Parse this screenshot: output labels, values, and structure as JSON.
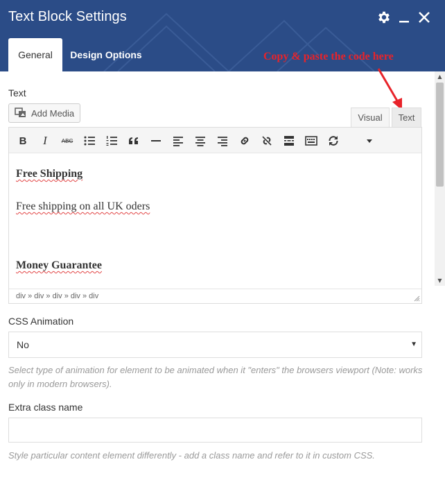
{
  "header": {
    "title": "Text Block Settings",
    "bg_color": "#2b4c87",
    "icons": [
      "gear-icon",
      "minimize-icon",
      "close-icon"
    ]
  },
  "tabs": [
    {
      "label": "General",
      "active": true
    },
    {
      "label": "Design Options",
      "active": false
    }
  ],
  "annotation": {
    "text": "Copy & paste the code here",
    "color": "#e8232a"
  },
  "text_field": {
    "label": "Text",
    "add_media_label": "Add Media",
    "editor_tabs": [
      {
        "label": "Visual",
        "active": true
      },
      {
        "label": "Text",
        "active": false
      }
    ],
    "toolbar_icons": [
      "bold-icon",
      "italic-icon",
      "strikethrough-icon",
      "bulleted-list-icon",
      "numbered-list-icon",
      "blockquote-icon",
      "horizontal-line-icon",
      "align-left-icon",
      "align-center-icon",
      "align-right-icon",
      "link-icon",
      "unlink-icon",
      "read-more-icon",
      "toolbar-toggle-icon",
      "refresh-icon",
      "dropdown-icon"
    ],
    "toolbar_labels": {
      "bold": "B",
      "italic": "I",
      "strike": "ABC"
    },
    "content": {
      "heading1": "Free Shipping",
      "para1": "Free shipping on all UK oders",
      "heading2": "Money Guarantee"
    },
    "path": "div » div » div » div » div"
  },
  "css_animation": {
    "label": "CSS Animation",
    "value": "No",
    "help": "Select type of animation for element to be animated when it \"enters\" the browsers viewport (Note: works only in modern browsers)."
  },
  "extra_class": {
    "label": "Extra class name",
    "value": "",
    "placeholder": "",
    "help": "Style particular content element differently - add a class name and refer to it in custom CSS."
  }
}
